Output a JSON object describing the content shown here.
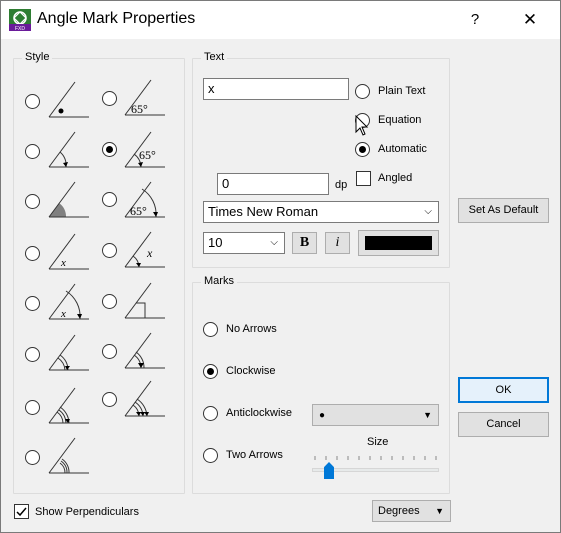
{
  "window": {
    "title": "Angle Mark Properties",
    "help_label": "?",
    "close_label": "✕"
  },
  "style_group": {
    "label": "Style",
    "angle_label": "65°",
    "x_label": "x",
    "selected_index": 5
  },
  "text_group": {
    "label": "Text",
    "text_value": "x",
    "plain_text_label": "Plain Text",
    "equation_label": "Equation",
    "automatic_label": "Automatic",
    "angled_label": "Angled",
    "dp_value": "0",
    "dp_label": "dp",
    "font_value": "Times New Roman",
    "size_value": "10",
    "bold_label": "B",
    "italic_label": "i",
    "color_value": "#000000"
  },
  "marks_group": {
    "label": "Marks",
    "no_arrows_label": "No Arrows",
    "clockwise_label": "Clockwise",
    "anticlockwise_label": "Anticlockwise",
    "two_arrows_label": "Two Arrows",
    "arrow_style_value": "●",
    "size_label": "Size",
    "size_level": 0.1
  },
  "buttons": {
    "set_default_label": "Set As Default",
    "ok_label": "OK",
    "cancel_label": "Cancel"
  },
  "footer": {
    "show_perpendiculars_label": "Show Perpendiculars",
    "units_value": "Degrees"
  }
}
